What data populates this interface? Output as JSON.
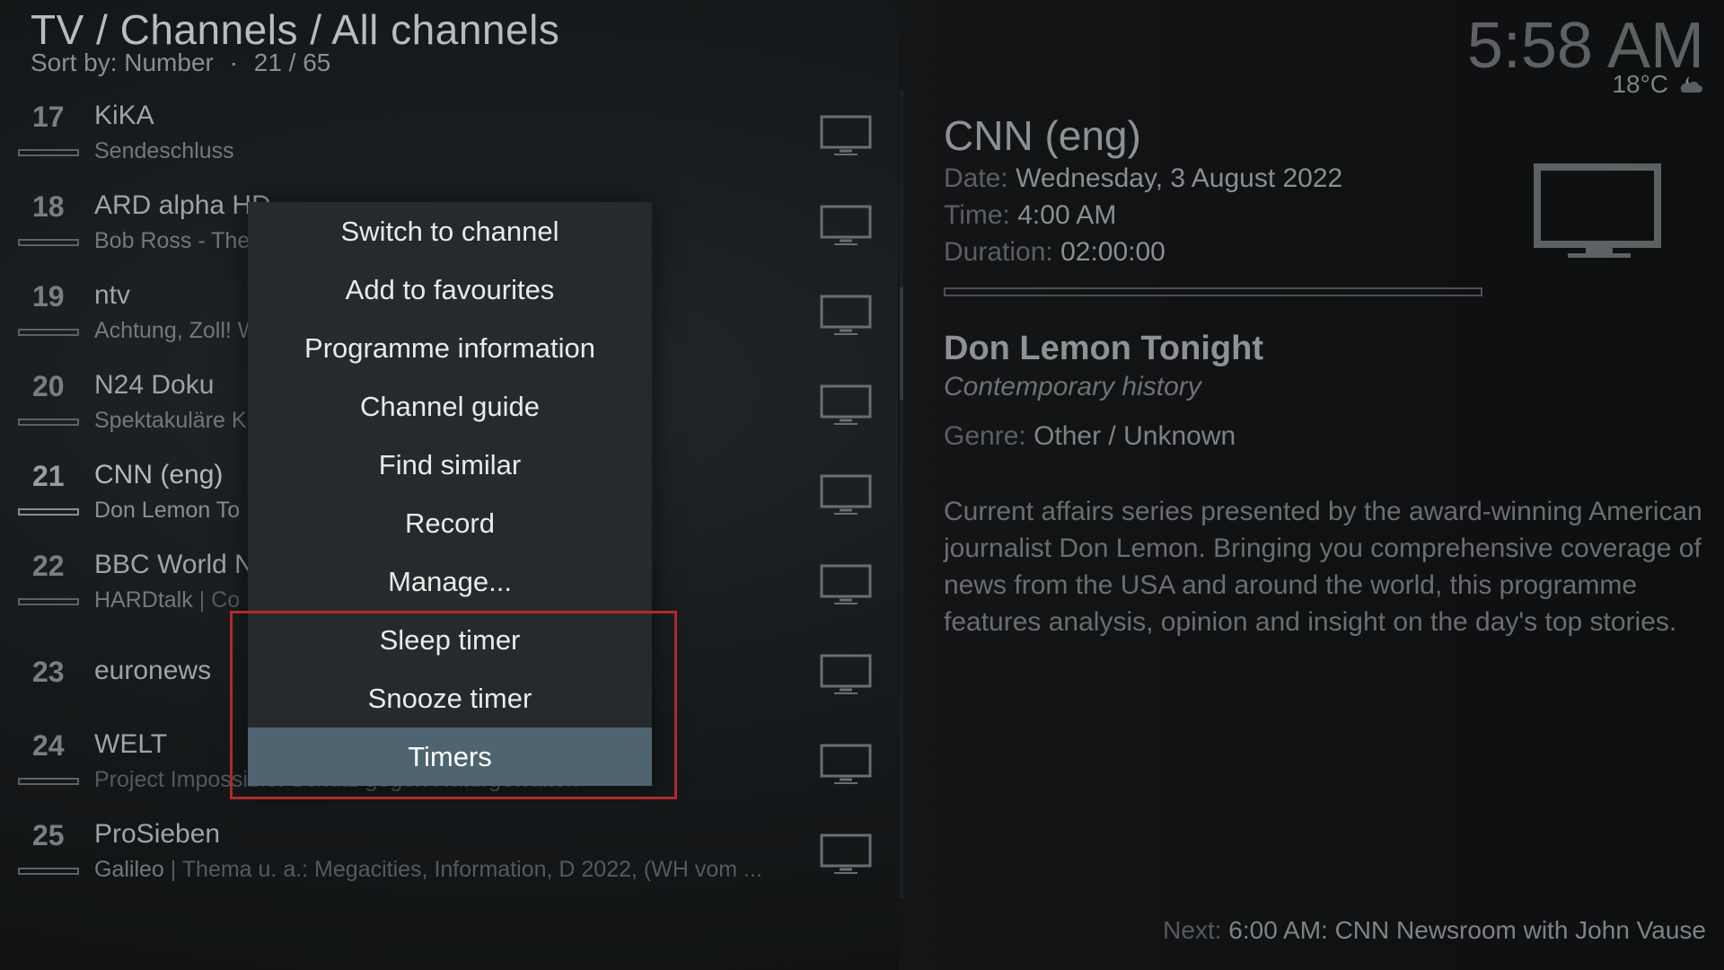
{
  "header": {
    "title": "TV / Channels / All channels",
    "sort_label": "Sort by: Number",
    "separator": "·",
    "position": "21 / 65"
  },
  "clock": {
    "time": "5:58 AM",
    "temperature": "18°C",
    "weather_icon": "cloudy-night-icon"
  },
  "channels": [
    {
      "number": "17",
      "name": "KiKA",
      "programme": "Sendeschluss",
      "programme_rest": ""
    },
    {
      "number": "18",
      "name": "ARD alpha HD",
      "programme": "Bob Ross - The",
      "programme_rest": ""
    },
    {
      "number": "19",
      "name": "ntv",
      "programme": "Achtung, Zoll! W",
      "programme_rest": ""
    },
    {
      "number": "20",
      "name": "N24 Doku",
      "programme": "Spektakuläre K",
      "programme_rest": ""
    },
    {
      "number": "21",
      "name": "CNN (eng)",
      "programme": "Don Lemon To",
      "programme_rest": ""
    },
    {
      "number": "22",
      "name": "BBC World N",
      "programme": "HARDtalk",
      "programme_rest": "Co"
    },
    {
      "number": "23",
      "name": "euronews",
      "programme": "",
      "programme_rest": ""
    },
    {
      "number": "24",
      "name": "WELT",
      "programme": "Project Impossible: Schutz gegen Naturgewalten",
      "programme_rest": ""
    },
    {
      "number": "25",
      "name": "ProSieben",
      "programme": "Galileo",
      "programme_rest": "Thema u. a.: Megacities, Information, D 2022, (WH vom ..."
    }
  ],
  "info": {
    "channel": "CNN (eng)",
    "date_label": "Date:",
    "date_value": "Wednesday, 3 August 2022",
    "time_label": "Time:",
    "time_value": "4:00 AM",
    "duration_label": "Duration:",
    "duration_value": "02:00:00",
    "show_title": "Don Lemon Tonight",
    "show_subtitle": "Contemporary history",
    "genre_label": "Genre:",
    "genre_value": "Other / Unknown",
    "description": "Current affairs series presented by the award-winning American journalist Don Lemon. Bringing you comprehensive coverage of news from the USA and around the world, this programme features analysis, opinion and insight on the day's top stories.",
    "next_label": "Next:",
    "next_value": "6:00 AM: CNN Newsroom with John Vause"
  },
  "context_menu": {
    "items": [
      "Switch to channel",
      "Add to favourites",
      "Programme information",
      "Channel guide",
      "Find similar",
      "Record",
      "Manage...",
      "Sleep timer",
      "Snooze timer",
      "Timers"
    ],
    "selected": "Timers"
  },
  "colors": {
    "menu_selected": "#4e6470",
    "highlight_border": "#b02a2a"
  }
}
